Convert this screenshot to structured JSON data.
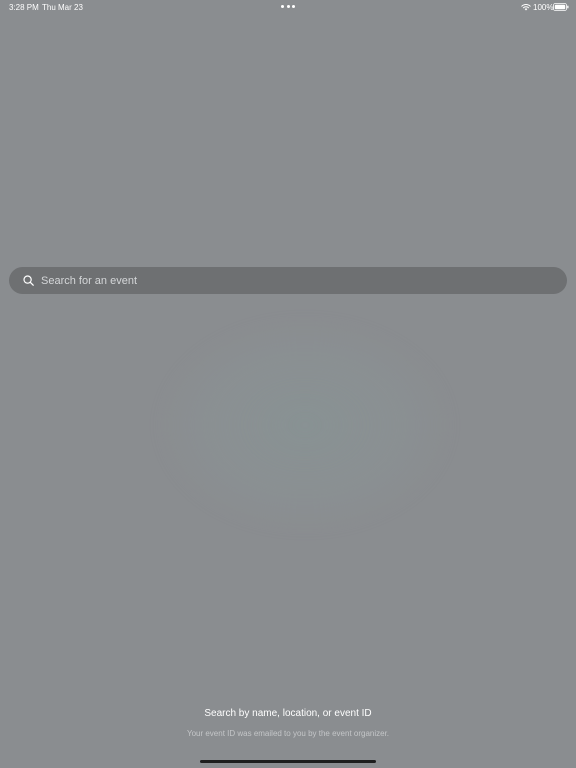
{
  "status_bar": {
    "time": "3:28 PM",
    "date": "Thu Mar 23",
    "battery": "100%",
    "icons": [
      "wifi-icon",
      "battery-icon",
      "more-dots-icon"
    ]
  },
  "search": {
    "placeholder": "Search for an event",
    "value": "",
    "icon": "search-icon"
  },
  "hint": {
    "title": "Search by name, location, or event ID",
    "subtitle": "Your event ID was emailed to you by the event organizer."
  },
  "colors": {
    "background": "#8a8d90",
    "search_bar": "#6e7072",
    "text_primary": "#ffffff",
    "text_secondary": "#c4c6c8"
  }
}
